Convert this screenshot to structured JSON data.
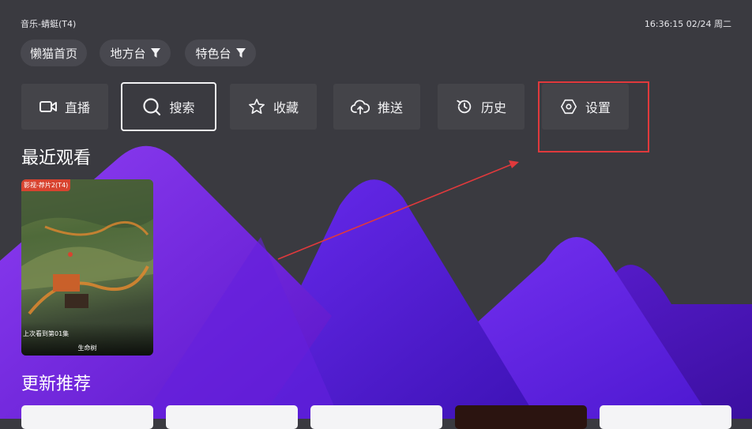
{
  "window": {
    "title": "音乐-蜻蜓(T4)",
    "clock": "16:36:15 02/24 周二"
  },
  "chips": [
    {
      "label": "懒猫首页",
      "filter": false
    },
    {
      "label": "地方台",
      "filter": true
    },
    {
      "label": "特色台",
      "filter": true
    }
  ],
  "nav": [
    {
      "label": "直播",
      "icon": "camera-icon"
    },
    {
      "label": "搜索",
      "icon": "search-icon"
    },
    {
      "label": "收藏",
      "icon": "star-icon"
    },
    {
      "label": "推送",
      "icon": "cloud-upload-icon"
    },
    {
      "label": "历史",
      "icon": "history-icon"
    },
    {
      "label": "设置",
      "icon": "settings-icon"
    }
  ],
  "recent": {
    "title": "最近观看",
    "items": [
      {
        "tag": "影视-荐片2(T4)",
        "progress": "上次看到第01集",
        "name": "生命树"
      }
    ]
  },
  "updates": {
    "title": "更新推荐"
  },
  "colors": {
    "background": "#3a3a40",
    "accent_purple": "#7b2ff0",
    "annotation_red": "#e0393c"
  }
}
